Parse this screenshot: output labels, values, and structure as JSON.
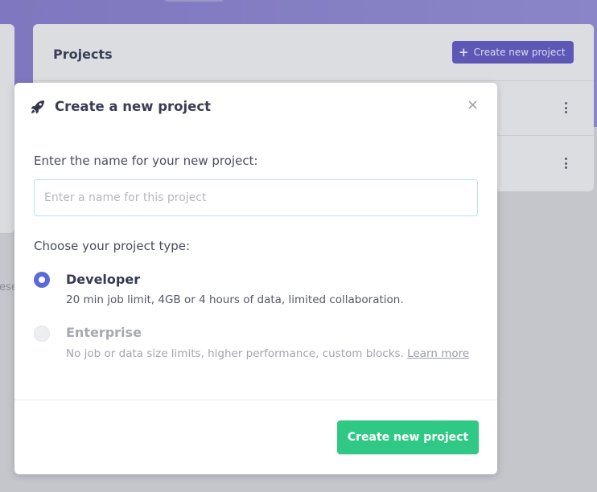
{
  "background": {
    "projects_title": "Projects",
    "create_button_label": "Create new project",
    "left_partial_text": "rese"
  },
  "modal": {
    "title": "Create a new project",
    "name_prompt": "Enter the name for your new project:",
    "name_input": {
      "value": "",
      "placeholder": "Enter a name for this project"
    },
    "type_prompt": "Choose your project type:",
    "options": [
      {
        "title": "Developer",
        "description": "20 min job limit, 4GB or 4 hours of data, limited collaboration.",
        "selected": true
      },
      {
        "title": "Enterprise",
        "description": "No job or data size limits, higher performance, custom blocks.",
        "link": "Learn more",
        "selected": false
      }
    ],
    "submit_label": "Create new project"
  },
  "icons": {
    "header": "rocket-icon",
    "close": "close-icon",
    "row_menu": "kebab-menu-icon",
    "add": "plus-icon"
  },
  "colors": {
    "accent": "#5b6ad8",
    "primary_button": "#2fc985",
    "banner": "#4636b4"
  }
}
